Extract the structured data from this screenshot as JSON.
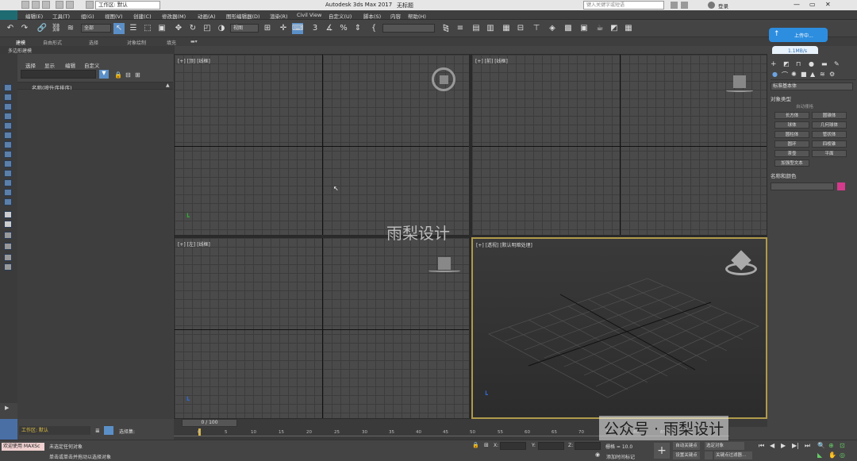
{
  "window": {
    "title": "Autodesk 3ds Max 2017",
    "doc": "无标题"
  },
  "workspace": "工作区: 默认",
  "search_placeholder": "键入关键字或短语",
  "user": "登录",
  "menu": [
    "编辑(E)",
    "工具(T)",
    "组(G)",
    "视图(V)",
    "创建(C)",
    "修改器(M)",
    "动画(A)",
    "图形编辑器(D)",
    "渲染(R)",
    "Civil View",
    "自定义(U)",
    "脚本(S)",
    "内容",
    "帮助(H)"
  ],
  "toolbar": {
    "filter": "全部",
    "refsys": "视图"
  },
  "ribbon_tabs": [
    "建模",
    "自由形式",
    "选择",
    "对象绘制",
    "填充"
  ],
  "ribbon_sub": "多边形建模",
  "explorer": {
    "tabs": [
      "选择",
      "显示",
      "编辑",
      "自定义"
    ],
    "column": "名称(按升序排序)"
  },
  "viewports": [
    {
      "label": "[+] [顶] [线框]"
    },
    {
      "label": "[+] [前] [线框]"
    },
    {
      "label": "[+] [左] [线框]"
    },
    {
      "label": "[+] [透视] [默认明暗处理]"
    }
  ],
  "watermark_center": "雨梨设计",
  "watermark_corner": "公众号 · 雨梨设计",
  "cloud": {
    "upload": "上传中...",
    "speed": "1.1MB/s"
  },
  "cmd": {
    "category": "标准基本体",
    "rollout1": "对象类型",
    "autogrid": "自动栅格",
    "objects": [
      "长方体",
      "圆锥体",
      "球体",
      "几何球体",
      "圆柱体",
      "管状体",
      "圆环",
      "四棱锥",
      "茶壶",
      "平面",
      "加强型文本"
    ],
    "rollout2": "名称和颜色",
    "obj_color": "#d43a8c"
  },
  "timeslider": "0 / 100",
  "ticks": [
    "0",
    "5",
    "10",
    "15",
    "20",
    "25",
    "30",
    "35",
    "40",
    "45",
    "50",
    "55",
    "60",
    "65",
    "70",
    "75",
    "80",
    "85",
    "90"
  ],
  "status": {
    "workspace_bottom": "工作区: 默认",
    "selection_set": "选择集:",
    "welcome": "欢迎使用 MAXSc",
    "msg1": "未选定任何对象",
    "msg2": "单击或单击并拖动以选择对象",
    "x_label": "X:",
    "y_label": "Y:",
    "z_label": "Z:",
    "grid": "栅格 = 10.0",
    "add_time_tag": "添加时间标记",
    "auto_key": "自动关键点",
    "set_key": "设置关键点",
    "selected": "选定对象",
    "key_filters": "关键点过滤器..."
  }
}
